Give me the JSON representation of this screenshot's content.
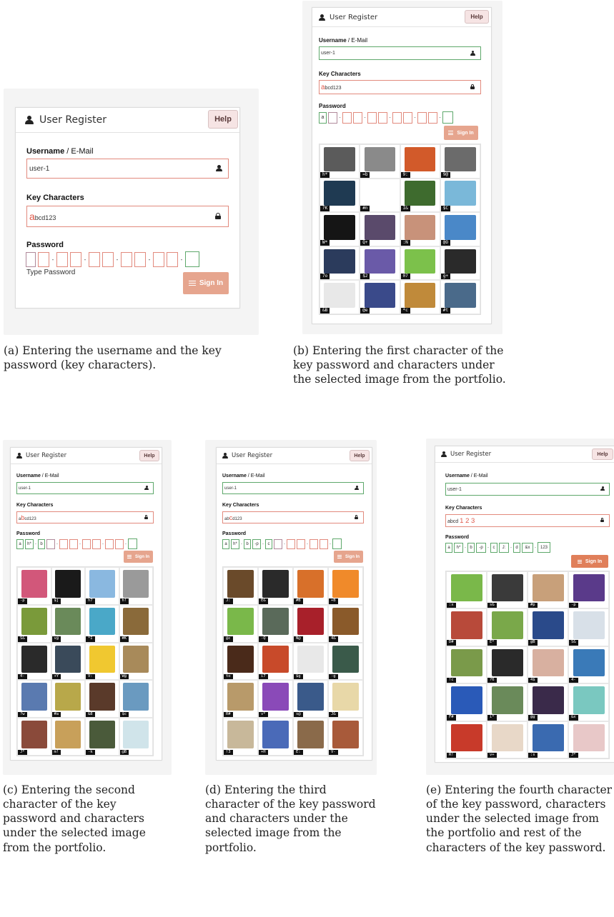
{
  "panels": [
    {
      "id": "a",
      "window_title": "User Register",
      "help_label": "Help",
      "username_label": "Username",
      "username_sep": " / E-Mail",
      "username_value": "user-1",
      "keychars_label": "Key Characters",
      "key_hl": "a",
      "key_rest": "bcd123",
      "password_label": "Password",
      "pw_boxes": [
        "",
        "",
        "",
        "",
        "",
        "",
        "",
        "",
        "",
        "",
        ""
      ],
      "type_password_label": "Type Password",
      "signin_label": "Sign In",
      "caption": "(a) Entering the username and the key password (key characters).",
      "tiles": []
    },
    {
      "id": "b",
      "window_title": "User Register",
      "help_label": "Help",
      "username_label": "Username",
      "username_sep": " / E-Mail",
      "username_value": "user-1",
      "keychars_label": "Key Characters",
      "key_hl": "a",
      "key_rest": "bcd123",
      "password_label": "Password",
      "pw_boxes": [
        "a",
        "",
        "",
        "",
        "",
        "",
        "",
        "",
        "",
        "",
        ""
      ],
      "signin_label": "Sign In",
      "caption": "(b) Entering the first character of the key password and characters under the selected image from the portfolio.",
      "tiles": [
        {
          "cap": "h*",
          "color": "#5b5b5b"
        },
        {
          "cap": "=b",
          "color": "#8a8a8a"
        },
        {
          "cap": "9:",
          "color": "#d25a2a"
        },
        {
          "cap": "9@",
          "color": "#6b6b6b"
        },
        {
          "cap": "?K",
          "color": "#1f3a52"
        },
        {
          "cap": "#n",
          "color": "#ffffff"
        },
        {
          "cap": "I&",
          "color": "#3e6b2e"
        },
        {
          "cap": "$C",
          "color": "#7ab8d9"
        },
        {
          "cap": "W*",
          "color": "#151515"
        },
        {
          "cap": "Q+",
          "color": "#5a4a6b"
        },
        {
          "cap": ":N",
          "color": "#c8927a"
        },
        {
          "cap": "@O",
          "color": "#4a88c8"
        },
        {
          "cap": "7o",
          "color": "#2b3b5c"
        },
        {
          "cap": "$2",
          "color": "#6a5aa8"
        },
        {
          "cap": "07",
          "color": "#7cc14b"
        },
        {
          "cap": "g+",
          "color": "#2a2a2a"
        },
        {
          "cap": "&B",
          "color": "#e8e8e8"
        },
        {
          "cap": "@e",
          "color": "#3a4a8a"
        },
        {
          "cap": "*c",
          "color": "#c08a3a"
        },
        {
          "cap": "#t",
          "color": "#4a6a8a"
        }
      ]
    },
    {
      "id": "c",
      "window_title": "User Register",
      "help_label": "Help",
      "username_label": "Username",
      "username_sep": " / E-Mail",
      "username_value": "user-1",
      "keychars_label": "Key Characters",
      "key_pre": "a",
      "key_hl": "b",
      "key_rest": "cd123",
      "password_label": "Password",
      "pw_boxes": [
        "a",
        "h*",
        "b",
        "",
        "",
        "",
        "",
        "",
        "",
        "",
        ""
      ],
      "signin_label": "Sign In",
      "caption": "(c) Entering the second character of the key password and characters under the selected image from the portfolio.",
      "tiles": [
        {
          "cap": "-p",
          "color": "#d2577a"
        },
        {
          "cap": "$j",
          "color": "#1a1a1a"
        },
        {
          "cap": "h7",
          "color": "#8ab8e0"
        },
        {
          "cap": "h!",
          "color": "#9a9a9a"
        },
        {
          "cap": "S&",
          "color": "#7a9a3a"
        },
        {
          "cap": "v@",
          "color": "#6a8a5a"
        },
        {
          "cap": "*I",
          "color": "#4aa8c8"
        },
        {
          "cap": "#K",
          "color": "#8a6a3a"
        },
        {
          "cap": "4-",
          "color": "#2a2a2a"
        },
        {
          "cap": "+Y",
          "color": "#3a4a5a"
        },
        {
          "cap": "V:",
          "color": "#f0c830"
        },
        {
          "cap": "W@",
          "color": "#a88a5a"
        },
        {
          "cap": "?w",
          "color": "#5a7ab0"
        },
        {
          "cap": "#a",
          "color": "#b8a84a"
        },
        {
          "cap": "&8",
          "color": "#5a3a2a"
        },
        {
          "cap": "$c",
          "color": "#6a9ac0"
        },
        {
          "cap": "J*",
          "color": "#8a4a3a"
        },
        {
          "cap": "m!",
          "color": "#c8a05a"
        },
        {
          "cap": "-k",
          "color": "#4a5a3a"
        },
        {
          "cap": "@B",
          "color": "#d0e4ea"
        }
      ]
    },
    {
      "id": "d",
      "window_title": "User Register",
      "help_label": "Help",
      "username_label": "Username",
      "username_sep": " / E-Mail",
      "username_value": "user-1",
      "keychars_label": "Key Characters",
      "key_pre": "ab",
      "key_hl": "c",
      "key_rest": "d123",
      "password_label": "Password",
      "pw_boxes": [
        "a",
        "h*",
        "b",
        "-p",
        "c",
        "",
        "",
        "",
        "",
        "",
        ""
      ],
      "signin_label": "Sign In",
      "caption": "(d) Entering the third character of the key password and characters under the selected image from the portfolio.",
      "tiles": [
        {
          "cap": "J:",
          "color": "#6a4a2a"
        },
        {
          "cap": "E&",
          "color": "#2a2a2a"
        },
        {
          "cap": "#B",
          "color": "#d8702a"
        },
        {
          "cap": "+B",
          "color": "#f08a2a"
        },
        {
          "cap": "@c",
          "color": "#7ab84a"
        },
        {
          "cap": "-Q",
          "color": "#5a6a5a"
        },
        {
          "cap": "N@",
          "color": "#a8202a"
        },
        {
          "cap": "4&",
          "color": "#8a5a2a"
        },
        {
          "cap": "to",
          "color": "#4a2a1a"
        },
        {
          "cap": "i7",
          "color": "#c84a2a"
        },
        {
          "cap": "$g",
          "color": "#e8e8e8"
        },
        {
          "cap": "-g",
          "color": "#3a5a4a"
        },
        {
          "cap": "R#",
          "color": "#b89a6a"
        },
        {
          "cap": "v*",
          "color": "#8a4ab8"
        },
        {
          "cap": "s@",
          "color": "#3a5a8a"
        },
        {
          "cap": "J&",
          "color": "#e8d8a8"
        },
        {
          "cap": "!3",
          "color": "#c8b89a"
        },
        {
          "cap": "+H",
          "color": "#4a6ab8"
        },
        {
          "cap": "E:",
          "color": "#8a6a4a"
        },
        {
          "cap": "V-",
          "color": "#a85a3a"
        }
      ]
    },
    {
      "id": "e",
      "window_title": "User Register",
      "help_label": "Help",
      "username_label": "Username",
      "username_sep": " / E-Mail",
      "username_value": "user-1",
      "keychars_label": "Key Characters",
      "key_pre": "abcd",
      "key_hl": "1 2 3",
      "key_rest": "",
      "password_label": "Password",
      "pw_boxes": [
        "a",
        "h*",
        "b",
        "-p",
        "c",
        "J:",
        "d",
        "&x",
        "123"
      ],
      "signin_label": "Sign In",
      "caption": "(e) Entering the fourth character of the key password, characters under the selected image from the portfolio and rest of the characters of the key password.",
      "tiles": [
        {
          "cap": ":x",
          "color": "#7ab84a"
        },
        {
          "cap": "s&",
          "color": "#3a3a3a"
        },
        {
          "cap": "#p",
          "color": "#c8a07a"
        },
        {
          "cap": "-p",
          "color": "#5a3a8a"
        },
        {
          "cap": "D#",
          "color": "#b84a3a"
        },
        {
          "cap": "E*",
          "color": "#7aa84a"
        },
        {
          "cap": "@B",
          "color": "#2a4a8a"
        },
        {
          "cap": "S&",
          "color": "#d8e0e8"
        },
        {
          "cap": "!c",
          "color": "#7a9a4a"
        },
        {
          "cap": "?6",
          "color": "#2a2a2a"
        },
        {
          "cap": "4$",
          "color": "#d8b0a0"
        },
        {
          "cap": "4-",
          "color": "#3a7ab8"
        },
        {
          "cap": "F#",
          "color": "#2a5ab8"
        },
        {
          "cap": "i*",
          "color": "#6a8a5a"
        },
        {
          "cap": "@g",
          "color": "#3a2a4a"
        },
        {
          "cap": "&x",
          "color": "#7ac8c0"
        },
        {
          "cap": "R!",
          "color": "#c83a2a"
        },
        {
          "cap": "v+",
          "color": "#e8d8c8"
        },
        {
          "cap": ":s",
          "color": "#3a6ab0"
        },
        {
          "cap": "J*",
          "color": "#e8c8c8"
        }
      ]
    }
  ]
}
